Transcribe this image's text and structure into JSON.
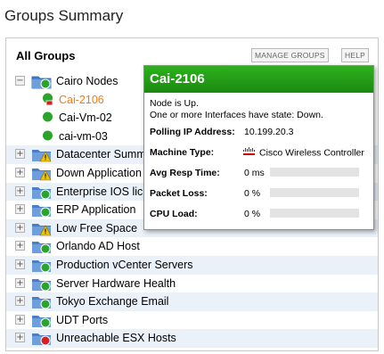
{
  "page": {
    "title": "Groups Summary"
  },
  "panel": {
    "title": "All Groups",
    "manage_label": "MANAGE GROUPS",
    "help_label": "HELP"
  },
  "tree": {
    "root": {
      "label": "Cairo Nodes",
      "toggle": "−"
    },
    "nodes": [
      {
        "label": "Cai-2106",
        "status": "up-warning"
      },
      {
        "label": "Cai-Vm-02",
        "status": "up"
      },
      {
        "label": "cai-vm-03",
        "status": "up"
      }
    ],
    "groups": [
      {
        "label": "Datacenter Summ",
        "status": "warning"
      },
      {
        "label": "Down Application",
        "status": "warning"
      },
      {
        "label": "Enterprise IOS lic",
        "status": "up"
      },
      {
        "label": "ERP Application",
        "status": "up"
      },
      {
        "label": "Low Free Space",
        "status": "warning"
      },
      {
        "label": "Orlando AD Host",
        "status": "up"
      },
      {
        "label": "Production vCenter Servers",
        "status": "up"
      },
      {
        "label": "Server Hardware Health",
        "status": "up"
      },
      {
        "label": "Tokyo Exchange Email",
        "status": "up"
      },
      {
        "label": "UDT Ports",
        "status": "up"
      },
      {
        "label": "Unreachable ESX Hosts",
        "status": "down"
      }
    ],
    "toggle_plus": "+"
  },
  "tooltip": {
    "title": "Cai-2106",
    "message_1": "Node is Up.",
    "message_2": "One or more Interfaces have state: Down.",
    "polling_label": "Polling IP Address:",
    "polling_value": "10.199.20.3",
    "machine_label": "Machine Type:",
    "machine_logo": "cisco",
    "machine_value": "Cisco Wireless Controller",
    "resp_label": "Avg Resp Time:",
    "resp_value": "0 ms",
    "loss_label": "Packet Loss:",
    "loss_value": "0 %",
    "cpu_label": "CPU Load:",
    "cpu_value": "0 %",
    "header_color": "#22a017"
  },
  "colors": {
    "up": "#2aa42a",
    "warning": "#f2c200",
    "down": "#d42020",
    "highlight": "#ef7b1a",
    "stripe": "#eaf1f9"
  }
}
